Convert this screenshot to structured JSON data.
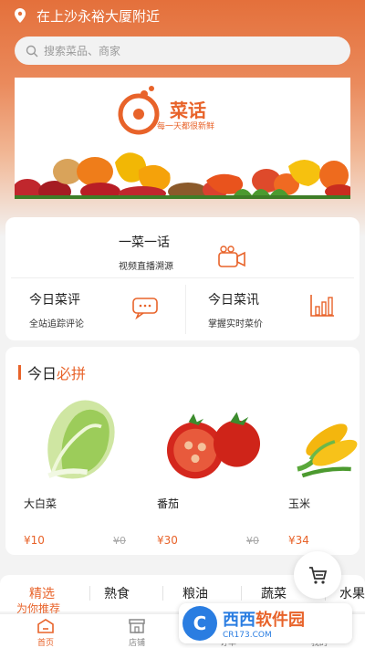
{
  "location": {
    "text": "在上沙永裕大厦附近",
    "icon": "location-pin-icon"
  },
  "search": {
    "placeholder": "搜索菜品、商家",
    "icon": "search-icon"
  },
  "banner": {
    "logo_title": "菜话",
    "slogan": "每一天都很新鲜"
  },
  "features": {
    "top": {
      "title": "一菜一话",
      "subtitle": "视频直播溯源",
      "icon": "video-camera-icon"
    },
    "left": {
      "title": "今日菜评",
      "subtitle": "全站追踪评论",
      "icon": "comment-icon"
    },
    "right": {
      "title": "今日菜讯",
      "subtitle": "掌握实时菜价",
      "icon": "bar-chart-icon"
    }
  },
  "deals": {
    "title_prefix": "今日",
    "title_accent": "必拼",
    "products": [
      {
        "name": "大白菜",
        "price": "¥10",
        "old_price": "¥0",
        "icon": "chinese-cabbage-icon"
      },
      {
        "name": "番茄",
        "price": "¥30",
        "old_price": "¥0",
        "icon": "tomato-icon"
      },
      {
        "name": "玉米",
        "price": "¥34",
        "old_price": "",
        "icon": "corn-icon"
      }
    ]
  },
  "categories": {
    "items": [
      "精选",
      "熟食",
      "粮油",
      "蔬菜",
      "水果"
    ],
    "selected_sub": "为你推荐"
  },
  "cart": {
    "icon": "cart-icon"
  },
  "tabbar": {
    "items": [
      {
        "label": "首页",
        "icon": "home-icon"
      },
      {
        "label": "店铺",
        "icon": "store-icon"
      },
      {
        "label": "订单",
        "icon": "order-icon"
      },
      {
        "label": "我的",
        "icon": "profile-icon"
      }
    ]
  },
  "watermark": {
    "logo": "C",
    "main_a": "西西",
    "main_b": "软件园",
    "sub": "CR173.COM"
  },
  "colors": {
    "accent": "#e8632a",
    "header": "#e4703b",
    "watermark": "#2a7de1"
  }
}
